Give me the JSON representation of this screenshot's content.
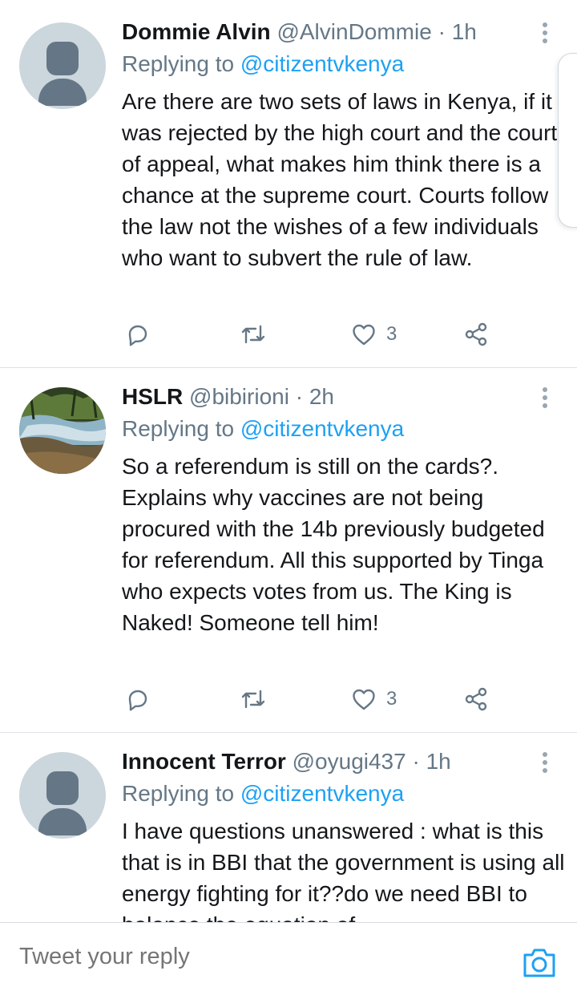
{
  "tweets": [
    {
      "name": "Dommie Alvin",
      "handle": "@AlvinDommie",
      "sep": "·",
      "time": "1h",
      "replying_prefix": "Replying to ",
      "replying_to": "@citizentvkenya",
      "text": "Are there are two sets of laws in Kenya, if it was rejected by the high court and the court of appeal, what makes him think there is a chance at the supreme court. Courts follow the law not the wishes of a few individuals who want to subvert the rule of law.",
      "likes": "3",
      "avatar": "default-avatar"
    },
    {
      "name": "HSLR",
      "handle": "@bibirioni",
      "sep": "·",
      "time": "2h",
      "replying_prefix": "Replying to ",
      "replying_to": "@citizentvkenya",
      "text": "So a referendum is still on the cards?. Explains why vaccines are not being procured with the 14b previously budgeted for referendum. All this supported by Tinga who expects votes from us. The King is Naked! Someone tell him!",
      "likes": "3",
      "avatar": "river-photo-avatar"
    },
    {
      "name": "Innocent Terror",
      "handle": "@oyugi437",
      "sep": "·",
      "time": "1h",
      "replying_prefix": "Replying to ",
      "replying_to": "@citizentvkenya",
      "text": "I have questions unanswered : what is this that is in BBI that the government is using all energy fighting for it??do we need BBI to balance the equation of",
      "avatar": "default-avatar"
    }
  ],
  "composer": {
    "placeholder": "Tweet your reply"
  },
  "icons": {
    "reply": "reply-icon",
    "retweet": "retweet-icon",
    "like": "heart-icon",
    "share": "share-icon",
    "more": "more-vertical-icon",
    "camera": "camera-icon"
  },
  "colors": {
    "accent": "#1da1f2",
    "text": "#14171a",
    "muted": "#657786",
    "divider": "#dfe3e6"
  }
}
